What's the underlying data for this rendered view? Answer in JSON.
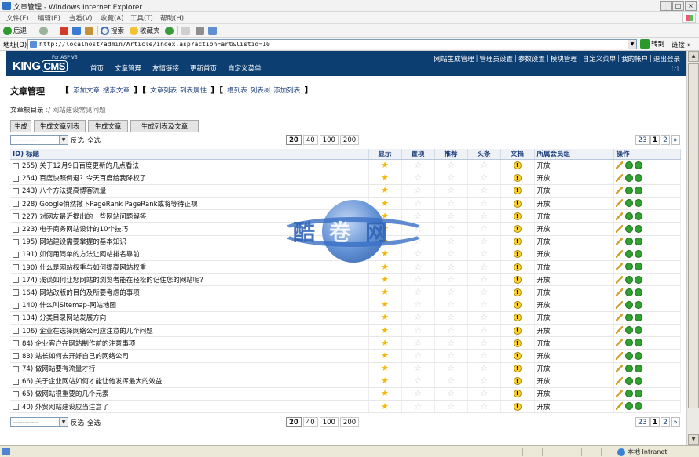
{
  "window": {
    "title": "文章管理 - Windows Internet Explorer",
    "controls": [
      "_",
      "□",
      "×"
    ]
  },
  "ie_menu": [
    "文件(F)",
    "编辑(E)",
    "查看(V)",
    "收藏(A)",
    "工具(T)",
    "帮助(H)"
  ],
  "ie_toolbar": {
    "back": "后退",
    "search": "搜索",
    "favorites": "收藏夹"
  },
  "address": {
    "label": "地址(D)",
    "url": "http://localhost/admin/Article/index.asp?action=art&listid=10",
    "go": "转到",
    "links": "链接",
    "links_chevron": "»"
  },
  "cms": {
    "logo_king": "KING",
    "logo_cms": "CMS",
    "logo_sub": "For ASP V5",
    "nav": [
      "首页",
      "文章管理",
      "友情链接",
      "更新首页",
      "自定义菜单"
    ],
    "top_links": [
      "网站生成管理",
      "管理员设置",
      "参数设置",
      "模块管理",
      "自定义菜单",
      "我的帐户",
      "退出登录"
    ],
    "top_sep": "|",
    "help": "[?]"
  },
  "page": {
    "title": "文章管理",
    "subnav": {
      "group1": [
        "添加文章",
        "搜索文章"
      ],
      "group2": [
        "文章列表",
        "列表属性"
      ],
      "group3": [
        "根列表",
        "列表树",
        "添加列表"
      ],
      "bracket_open": "[",
      "bracket_close": "]"
    },
    "root_label": "文章根目录",
    "root_path": ":/ 网站建设常见问题",
    "gen_buttons": [
      "生成",
      "生成文章列表",
      "生成文章",
      "生成列表及文章"
    ],
    "select_placeholder": "-----------",
    "invert": "反选",
    "select_all": "全选",
    "page_sizes": [
      "20",
      "40",
      "100",
      "200"
    ],
    "active_page_size": "20",
    "pages": [
      "23",
      "1",
      "2",
      "»"
    ],
    "active_page": "1"
  },
  "table": {
    "headers": [
      "ID) 标题",
      "显示",
      "置项",
      "推荐",
      "头条",
      "文档",
      "所属会员组",
      "操作"
    ],
    "rows": [
      {
        "id": "255)",
        "title": "关于12月9日百度更新的几点看法",
        "group": "开放"
      },
      {
        "id": "254)",
        "title": "百度快照倒退？今天百度给我降权了",
        "group": "开放"
      },
      {
        "id": "243)",
        "title": "八个方法提高博客流量",
        "group": "开放"
      },
      {
        "id": "228)",
        "title": "Google悄然撤下PageRank PageRank或将等待正视",
        "group": "开放"
      },
      {
        "id": "227)",
        "title": "对网友最近提出的一些网站问题解答",
        "group": "开放"
      },
      {
        "id": "223)",
        "title": "电子商务网站设计的10个技巧",
        "group": "开放"
      },
      {
        "id": "195)",
        "title": "网站建设需要掌握的基本知识",
        "group": "开放"
      },
      {
        "id": "191)",
        "title": "如何用简单的方法让网站排名靠前",
        "group": "开放"
      },
      {
        "id": "190)",
        "title": "什么是网站权重与如何提高网站权重",
        "group": "开放"
      },
      {
        "id": "174)",
        "title": "浅谈如何让您网站的浏览者能在轻松的记住您的网站呢？",
        "group": "开放"
      },
      {
        "id": "164)",
        "title": "网站改版的目的及所要考虑的事项",
        "group": "开放"
      },
      {
        "id": "140)",
        "title": "什么叫Sitemap-网站地图",
        "group": "开放"
      },
      {
        "id": "134)",
        "title": "分类目录网站发展方向",
        "group": "开放"
      },
      {
        "id": "106)",
        "title": "企业在选择网络公司应注意的几个问题",
        "group": "开放"
      },
      {
        "id": "84)",
        "title": "企业客户在网站制作前的注意事项",
        "group": "开放"
      },
      {
        "id": "83)",
        "title": "站长如何去开好自己的网络公司",
        "group": "开放"
      },
      {
        "id": "74)",
        "title": "做网站要有流量才行",
        "group": "开放"
      },
      {
        "id": "66)",
        "title": "关于企业网站如何才能让他发挥最大的效益",
        "group": "开放"
      },
      {
        "id": "65)",
        "title": "做网站很重要的几个元素",
        "group": "开放"
      },
      {
        "id": "40)",
        "title": "外贸网站建设应当注意了",
        "group": "开放"
      }
    ]
  },
  "statusbar": {
    "zone": "本地 Intranet"
  },
  "watermark": [
    "酷",
    "卷",
    "网"
  ]
}
